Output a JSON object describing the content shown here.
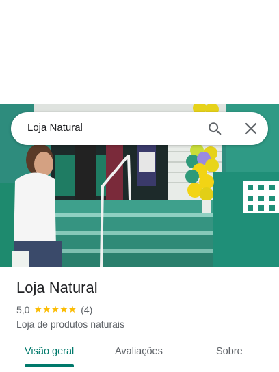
{
  "search": {
    "query": "Loja Natural"
  },
  "place": {
    "name": "Loja Natural",
    "rating": "5,0",
    "stars": "★★★★★",
    "review_count": "(4)",
    "category": "Loja de produtos naturais"
  },
  "tabs": [
    {
      "label": "Visão geral",
      "active": true
    },
    {
      "label": "Avaliações",
      "active": false
    },
    {
      "label": "Sobre",
      "active": false
    }
  ],
  "colors": {
    "accent": "#00796b",
    "star": "#fbbc04",
    "wall": "#2f8f7f"
  },
  "icons": [
    "search-icon",
    "close-icon"
  ]
}
